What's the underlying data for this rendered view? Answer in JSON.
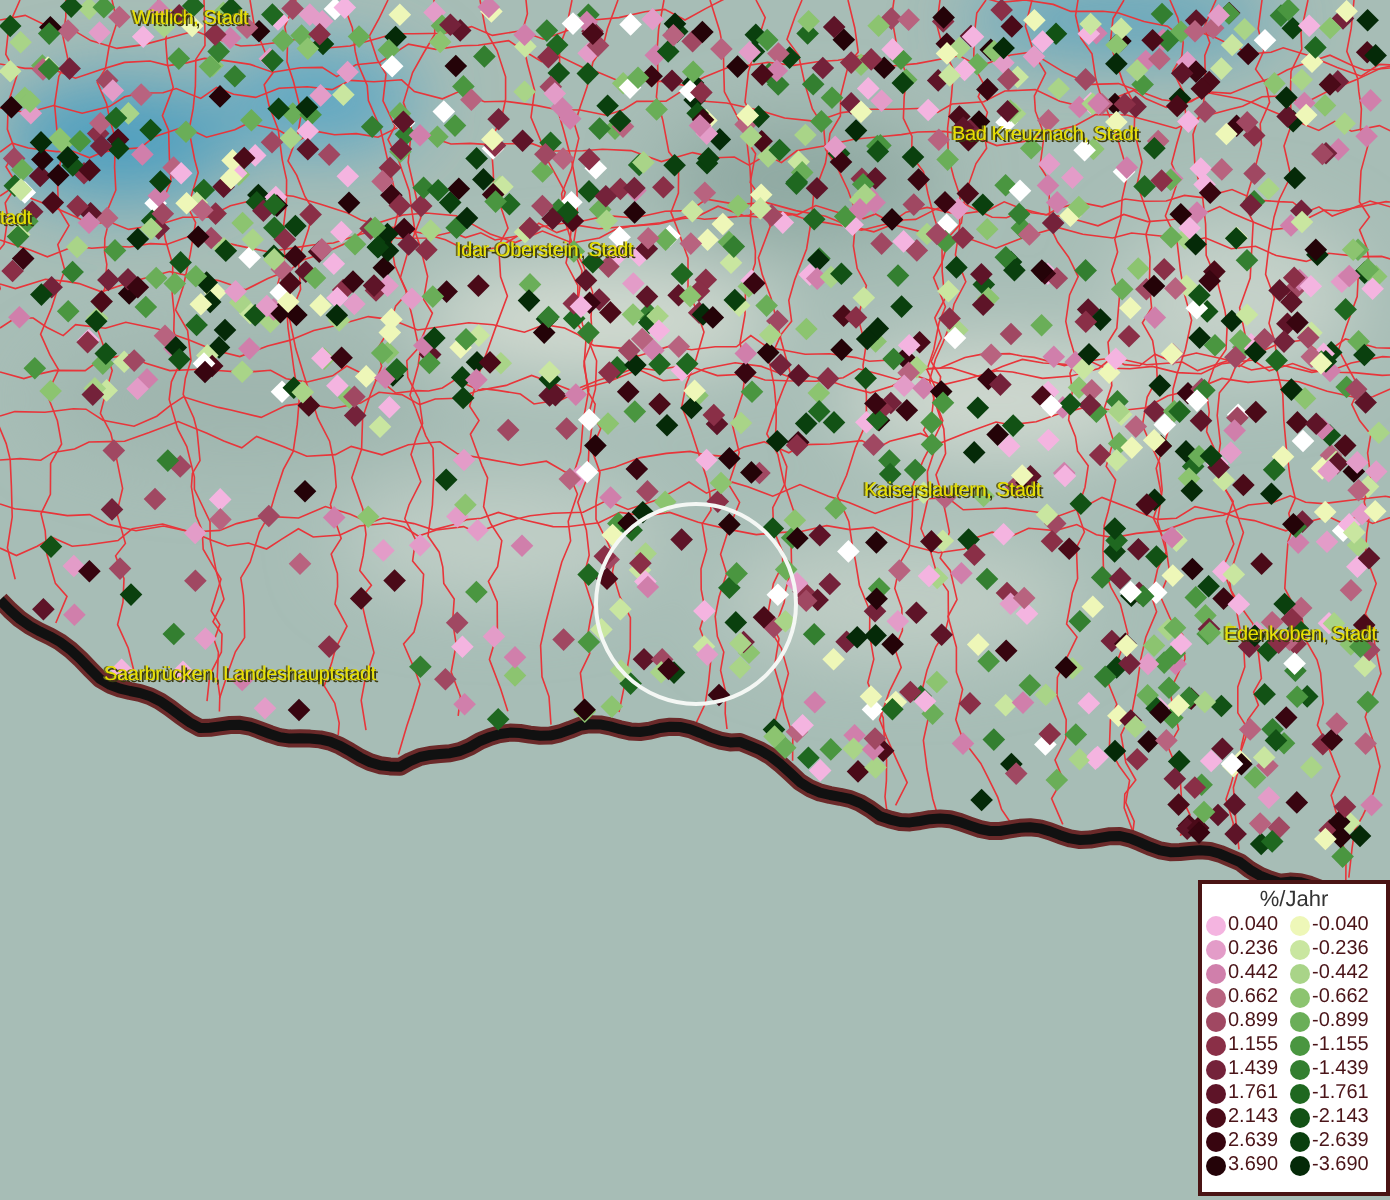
{
  "map": {
    "places": [
      {
        "name": "Wittlich, Stadt"
      },
      {
        "name": "tadt"
      },
      {
        "name": "Idar-Oberstein, Stadt"
      },
      {
        "name": "Bad Kreuznach, Stadt"
      },
      {
        "name": "Kaiserslautern, Stadt"
      },
      {
        "name": "Saarbrücken, Landeshauptstadt"
      },
      {
        "name": "Edenkoben, Stadt"
      }
    ]
  },
  "legend": {
    "title": "%/Jahr",
    "rows": [
      {
        "positive": {
          "value": "0.040",
          "color": "#f4b4e0"
        },
        "negative": {
          "value": "-0.040",
          "color": "#eef7b8"
        }
      },
      {
        "positive": {
          "value": "0.236",
          "color": "#e39cc8"
        },
        "negative": {
          "value": "-0.236",
          "color": "#c9e6a0"
        }
      },
      {
        "positive": {
          "value": "0.442",
          "color": "#d07fab"
        },
        "negative": {
          "value": "-0.442",
          "color": "#a9d488"
        }
      },
      {
        "positive": {
          "value": "0.662",
          "color": "#b8637f"
        },
        "negative": {
          "value": "-0.662",
          "color": "#8cc470"
        }
      },
      {
        "positive": {
          "value": "0.899",
          "color": "#a04862"
        },
        "negative": {
          "value": "-0.899",
          "color": "#6aae58"
        }
      },
      {
        "positive": {
          "value": "1.155",
          "color": "#8a2f47"
        },
        "negative": {
          "value": "-1.155",
          "color": "#4a9640"
        }
      },
      {
        "positive": {
          "value": "1.439",
          "color": "#74223a"
        },
        "negative": {
          "value": "-1.439",
          "color": "#337f30"
        }
      },
      {
        "positive": {
          "value": "1.761",
          "color": "#5e1428"
        },
        "negative": {
          "value": "-1.761",
          "color": "#1f6820"
        }
      },
      {
        "positive": {
          "value": "2.143",
          "color": "#4a0a18"
        },
        "negative": {
          "value": "-2.143",
          "color": "#125215"
        }
      },
      {
        "positive": {
          "value": "2.639",
          "color": "#380510"
        },
        "negative": {
          "value": "-2.639",
          "color": "#0a400e"
        }
      },
      {
        "positive": {
          "value": "3.690",
          "color": "#240308"
        },
        "negative": {
          "value": "-3.690",
          "color": "#052a08"
        }
      }
    ]
  }
}
